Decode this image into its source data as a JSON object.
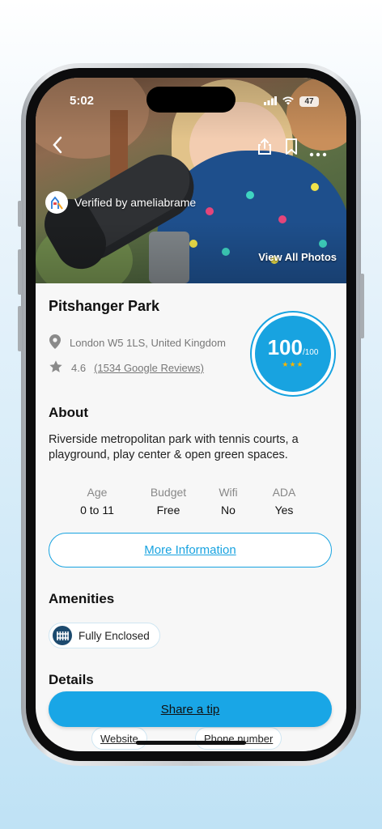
{
  "status": {
    "time": "5:02",
    "battery": "47"
  },
  "hero": {
    "verified_text": "Verified by ameliabrame",
    "view_all_photos": "View All Photos"
  },
  "park": {
    "name": "Pitshanger Park",
    "address": "London W5 1LS, United Kingdom",
    "rating": "4.6",
    "reviews": "(1534 Google Reviews)",
    "score": "100",
    "score_max": "/100",
    "score_stars": "★★★"
  },
  "about": {
    "heading": "About",
    "text": "Riverside metropolitan park with tennis courts, a playground, play center & open green spaces."
  },
  "stats": [
    {
      "label": "Age",
      "value": "0 to 11"
    },
    {
      "label": "Budget",
      "value": "Free"
    },
    {
      "label": "Wifi",
      "value": "No"
    },
    {
      "label": "ADA",
      "value": "Yes"
    }
  ],
  "more_info_label": "More Information",
  "amenities": {
    "heading": "Amenities",
    "items": [
      {
        "label": "Fully Enclosed",
        "icon": "fence-icon"
      }
    ]
  },
  "details": {
    "heading": "Details"
  },
  "share_tip_label": "Share a tip",
  "links": {
    "website": "Website",
    "phone": "Phone number"
  },
  "colors": {
    "accent": "#18a3e0",
    "star": "#f5b400",
    "background": "#f7f7f7"
  }
}
